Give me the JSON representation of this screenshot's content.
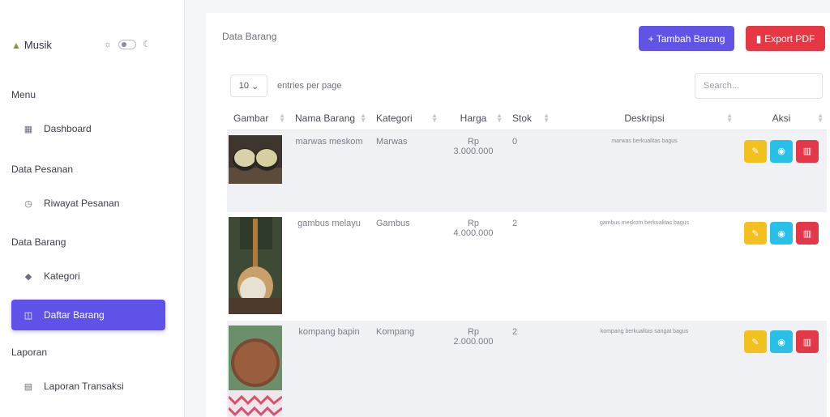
{
  "app": {
    "name": "Musik"
  },
  "sidebar": {
    "sections": [
      {
        "title": "Menu"
      },
      {
        "title": "Data Pesanan"
      },
      {
        "title": "Data Barang"
      },
      {
        "title": "Laporan"
      }
    ],
    "items": [
      {
        "label": "Dashboard",
        "icon": "grid-icon"
      },
      {
        "label": "Riwayat Pesanan",
        "icon": "history-icon"
      },
      {
        "label": "Kategori",
        "icon": "tag-icon"
      },
      {
        "label": "Daftar Barang",
        "icon": "box-icon",
        "active": true
      },
      {
        "label": "Laporan Transaksi",
        "icon": "report-icon"
      }
    ]
  },
  "main": {
    "title": "Data Barang",
    "add_button": "+ Tambah Barang",
    "export_button": "Export PDF",
    "entries_value": "10",
    "entries_label": "entries per page",
    "search_placeholder": "Search..."
  },
  "table": {
    "headers": [
      "Gambar",
      "Nama Barang",
      "Kategori",
      "Harga",
      "Stok",
      "Deskripsi",
      "Aksi"
    ],
    "rows": [
      {
        "nama": "marwas meskom",
        "kategori": "Marwas",
        "harga": "Rp 3.000.000",
        "stok": "0",
        "deskripsi": "marwas berkualitas bagus"
      },
      {
        "nama": "gambus melayu",
        "kategori": "Gambus",
        "harga": "Rp 4.000.000",
        "stok": "2",
        "deskripsi": "gambus meskom berkualitas bagus"
      },
      {
        "nama": "kompang bapin",
        "kategori": "Kompang",
        "harga": "Rp 2.000.000",
        "stok": "2",
        "deskripsi": "kompang berkualitas sangat bagus"
      }
    ]
  },
  "colors": {
    "primary": "#5f52e8",
    "danger": "#e53744",
    "warning": "#f2c01f",
    "info": "#28c0e6"
  }
}
